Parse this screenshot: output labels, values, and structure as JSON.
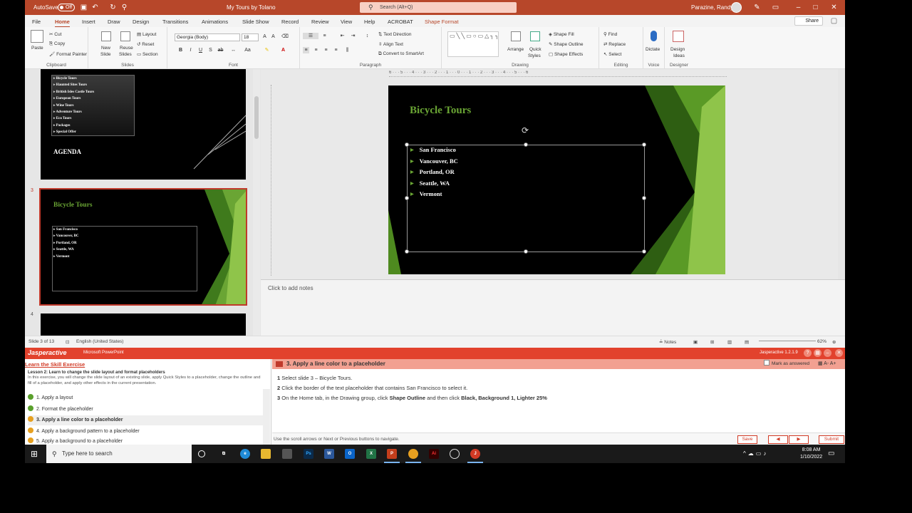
{
  "titlebar": {
    "autosave_label": "AutoSave",
    "autosave_state": "Off",
    "doc_title": "My Tours by Tolano",
    "search_placeholder": "Search (Alt+Q)",
    "user_name": "Parazine, Randy"
  },
  "tabs": [
    "File",
    "Home",
    "Insert",
    "Draw",
    "Design",
    "Transitions",
    "Animations",
    "Slide Show",
    "Record",
    "Review",
    "View",
    "Help",
    "ACROBAT",
    "Shape Format"
  ],
  "share_label": "Share",
  "ribbon": {
    "clipboard": {
      "paste": "Paste",
      "cut": "Cut",
      "copy": "Copy",
      "painter": "Format Painter",
      "label": "Clipboard"
    },
    "slides": {
      "new": "New",
      "new2": "Slide",
      "reuse": "Reuse",
      "reuse2": "Slides",
      "layout": "Layout",
      "reset": "Reset",
      "section": "Section",
      "label": "Slides"
    },
    "font": {
      "name": "Georgia (Body)",
      "size": "18",
      "label": "Font"
    },
    "paragraph": {
      "direction": "Text Direction",
      "align": "Align Text",
      "smartart": "Convert to SmartArt",
      "label": "Paragraph"
    },
    "drawing": {
      "arrange": "Arrange",
      "quick": "Quick",
      "styles": "Styles",
      "fill": "Shape Fill",
      "outline": "Shape Outline",
      "effects": "Shape Effects",
      "label": "Drawing"
    },
    "editing": {
      "find": "Find",
      "replace": "Replace",
      "select": "Select",
      "label": "Editing"
    },
    "voice": {
      "dictate": "Dictate",
      "label": "Voice"
    },
    "designer": {
      "ideas1": "Design",
      "ideas2": "Ideas",
      "label": "Designer"
    }
  },
  "thumbnails": {
    "slide2": {
      "items": [
        "Bicycle Tours",
        "Haunted Sites Tours",
        "British Isles Castle Tours",
        "European Tours",
        "Wine Tours",
        "Adventure Tours",
        "Eco Tours",
        "Packages",
        "Special Offer"
      ],
      "title": "AGENDA"
    },
    "slide3": {
      "number": "3",
      "title": "Bicycle Tours",
      "items": [
        "San Francisco",
        "Vancouver, BC",
        "Portland, OR",
        "Seattle, WA",
        "Vermont"
      ]
    },
    "slide4": {
      "number": "4"
    }
  },
  "ruler_text": "6 · · · 5 · · · 4 · · · 3 · · · 2 · · · 1 · · · 0 · · · 1 · · · 2 · · · 3 · · · 4 · · · 5 · · · 6",
  "slide": {
    "title": "Bicycle Tours",
    "bullets": [
      "San Francisco",
      "Vancouver, BC",
      "Portland, OR",
      "Seattle, WA",
      "Vermont"
    ]
  },
  "notes_placeholder": "Click to add notes",
  "status": {
    "slide_count": "Slide 3 of 13",
    "language": "English (United States)",
    "notes": "Notes",
    "zoom": "62%"
  },
  "jasper": {
    "brand": "Jasperactive",
    "app": "Microsoft PowerPoint",
    "version": "Jasperactive 1.2.1.9",
    "left_title": "Learn the Skill Exercise",
    "lesson": "Lesson 2: Learn to change the slide layout and format placeholders",
    "description": "In this exercise, you will change the slide layout of an existing slide, apply Quick Styles to a placeholder, change the outline and fill of a placeholder, and apply other effects in the current presentation.",
    "steps": [
      {
        "label": "1. Apply a layout",
        "color": "#5aa02c"
      },
      {
        "label": "2. Format the placeholder",
        "color": "#5aa02c"
      },
      {
        "label": "3. Apply a line color to a placeholder",
        "color": "#e6a020"
      },
      {
        "label": "4. Apply a background pattern to a placeholder",
        "color": "#e6a020"
      },
      {
        "label": "5. Apply a background to a placeholder",
        "color": "#e6a020"
      }
    ],
    "task_title": "3. Apply a line color to a placeholder",
    "mark_answered": "Mark as answered",
    "instructions": [
      {
        "num": "1",
        "text": "Select slide 3 – Bicycle Tours."
      },
      {
        "num": "2",
        "text": "Click the border of the text placeholder that contains San Francisco to select it."
      },
      {
        "num": "3",
        "pre": "On the Home tab, in the Drawing group, click ",
        "b1": "Shape Outline",
        "mid": " and then click ",
        "b2": "Black, Background 1, Lighter 25%"
      }
    ],
    "footer_nav": "Use the scroll arrows or Next or Previous buttons to navigate.",
    "save": "Save",
    "submit": "Submit"
  },
  "taskbar": {
    "search": "Type here to search",
    "time": "8:08 AM",
    "date": "1/10/2022"
  },
  "colors": {
    "ppt_red": "#b7472a",
    "slide_green": "#6aa534",
    "jasper_red": "#e2422d"
  }
}
